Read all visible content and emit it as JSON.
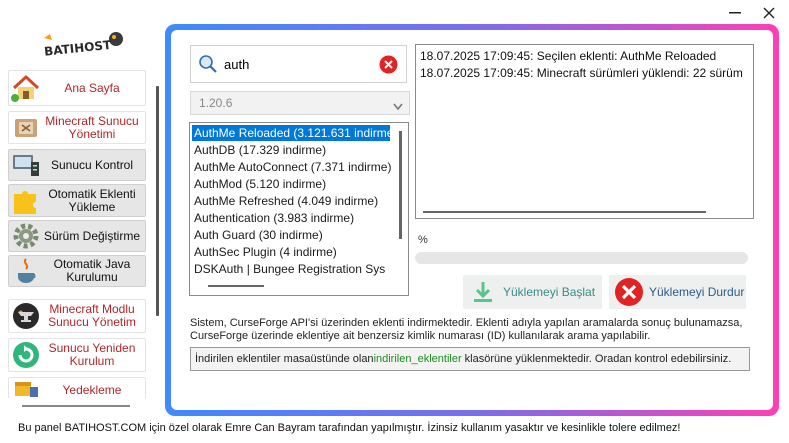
{
  "window": {
    "minimize_icon": "minimize-icon",
    "close_icon": "close-icon"
  },
  "logo": {
    "text": "BATIHOST"
  },
  "sidebar": {
    "items": [
      {
        "label": "Ana Sayfa",
        "icon": "house-icon"
      },
      {
        "label": "Minecraft Sunucu Yönetimi",
        "icon": "minecraft-book-icon"
      },
      {
        "label": "Sunucu Kontrol",
        "icon": "server-control-icon"
      },
      {
        "label": "Otomatik Eklenti Yükleme",
        "icon": "puzzle-icon"
      },
      {
        "label": "Sürüm Değiştirme",
        "icon": "gear-icon"
      },
      {
        "label": "Otomatik Java Kurulumu",
        "icon": "java-icon"
      },
      {
        "label": "Minecraft Modlu Sunucu Yönetim",
        "icon": "anvil-icon"
      },
      {
        "label": "Sunucu Yeniden Kurulum",
        "icon": "refresh-icon"
      },
      {
        "label": "Yedekleme",
        "icon": "backup-icon"
      }
    ]
  },
  "search": {
    "value": "auth",
    "placeholder": ""
  },
  "version_select": {
    "selected": "1.20.6"
  },
  "plugin_list": {
    "items": [
      "AuthMe Reloaded (3.121.631 indirme)",
      "AuthDB (17.329 indirme)",
      "AuthMe AutoConnect (7.371 indirme)",
      "AuthMod (5.120 indirme)",
      "AuthMe Refreshed (4.049 indirme)",
      "Authentication (3.983 indirme)",
      "Auth Guard (30 indirme)",
      "AuthSec Plugin (4 indirme)",
      "DSKAuth | Bungee Registration Sys"
    ],
    "selected_index": 0
  },
  "log": {
    "lines": [
      "18.07.2025 17:09:45: Seçilen eklenti: AuthMe Reloaded",
      "18.07.2025 17:09:45: Minecraft sürümleri yüklendi: 22 sürüm"
    ]
  },
  "progress": {
    "label": "%",
    "value": 0
  },
  "buttons": {
    "start": "Yüklemeyi Başlat",
    "stop": "Yüklemeyi Durdur"
  },
  "info": {
    "text": "Sistem, CurseForge API'si üzerinden eklenti indirmektedir. Eklenti adıyla yapılan aramalarda sonuç bulunamazsa, CurseForge üzerinde eklentiye ait benzersiz kimlik numarası (ID) kullanılarak arama yapılabilir.",
    "notice_before": "İndirilen eklentiler masaüstünde olan ",
    "notice_folder": "indirilen_eklentiler",
    "notice_after": " klasörüne yüklenmektedir. Oradan kontrol edebilirsiniz."
  },
  "footer": "Bu panel BATIHOST.COM için özel olarak Emre Can Bayram tarafından yapılmıştır. İzinsiz kullanım yasaktır ve kesinlikle tolere edilmez!",
  "colors": {
    "frame_left": "#3e8bff",
    "frame_right": "#ff3fb4",
    "sidebar_red": "#b3262a",
    "selection": "#0078d7",
    "notice_green": "#1e8a1e"
  }
}
